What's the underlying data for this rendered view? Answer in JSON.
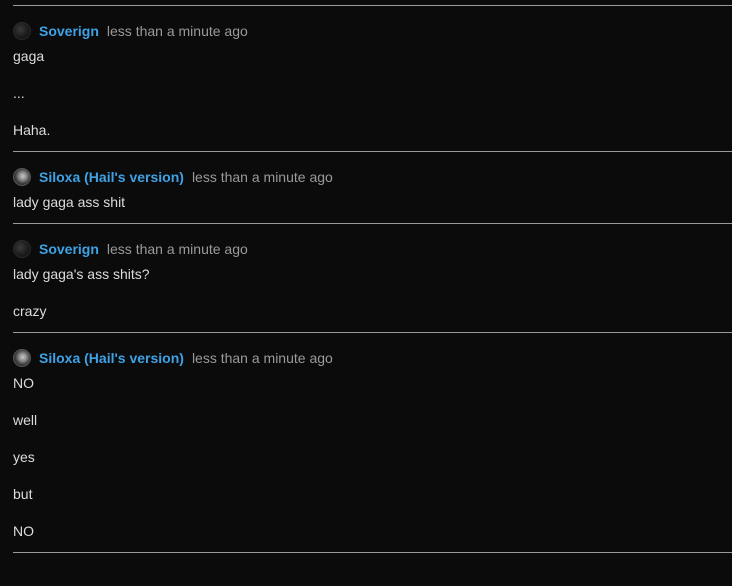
{
  "posts": [
    {
      "author": "Soverign",
      "avatar_icon": "dark-orb-avatar",
      "time": "less than a minute ago",
      "lines": [
        "gaga",
        "...",
        "Haha."
      ]
    },
    {
      "author": "Siloxa (Hail's version)",
      "avatar_icon": "silver-orb-avatar",
      "time": "less than a minute ago",
      "lines": [
        "lady gaga ass shit"
      ]
    },
    {
      "author": "Soverign",
      "avatar_icon": "dark-orb-avatar",
      "time": "less than a minute ago",
      "lines": [
        "lady gaga's ass shits?",
        "crazy"
      ]
    },
    {
      "author": "Siloxa (Hail's version)",
      "avatar_icon": "silver-orb-avatar",
      "time": "less than a minute ago",
      "lines": [
        "NO",
        "well",
        "yes",
        "but",
        "NO"
      ]
    }
  ],
  "colors": {
    "background": "#0b0b0c",
    "username": "#3ea2e5",
    "timestamp": "#9a9a9a",
    "text": "#dcdcdc",
    "divider": "#9a9a9a"
  }
}
